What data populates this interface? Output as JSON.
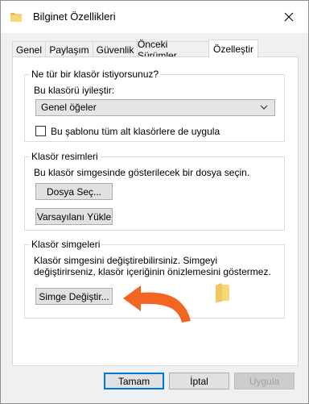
{
  "window": {
    "title": "Bilginet Özellikleri"
  },
  "tabs": [
    {
      "label": "Genel"
    },
    {
      "label": "Paylaşım"
    },
    {
      "label": "Güvenlik"
    },
    {
      "label": "Önceki Sürümler"
    },
    {
      "label": "Özelleştir",
      "active": true
    }
  ],
  "optimize_group": {
    "title": "Ne tür bir klasör istiyorsunuz?",
    "optimize_label": "Bu klasörü iyileştir:",
    "optimize_value": "Genel öğeler",
    "apply_subfolders_label": "Bu şablonu tüm alt klasörlere de uygula",
    "apply_subfolders_checked": false
  },
  "pictures_group": {
    "title": "Klasör resimleri",
    "description": "Bu klasör simgesinde gösterilecek bir dosya seçin.",
    "choose_file_button": "Dosya Seç...",
    "restore_default_button": "Varsayılanı Yükle"
  },
  "icons_group": {
    "title": "Klasör simgeleri",
    "description": "Klasör simgesini değiştirebilirsiniz. Simgeyi değiştirirseniz, klasör içeriğinin önizlemesini göstermez.",
    "change_icon_button": "Simge Değiştir..."
  },
  "footer": {
    "ok_button": "Tamam",
    "cancel_button": "İptal",
    "apply_button": "Uygula"
  },
  "colors": {
    "folder_yellow": "#f8d775",
    "arrow_orange": "#f26522",
    "accent_blue": "#0078d7"
  }
}
